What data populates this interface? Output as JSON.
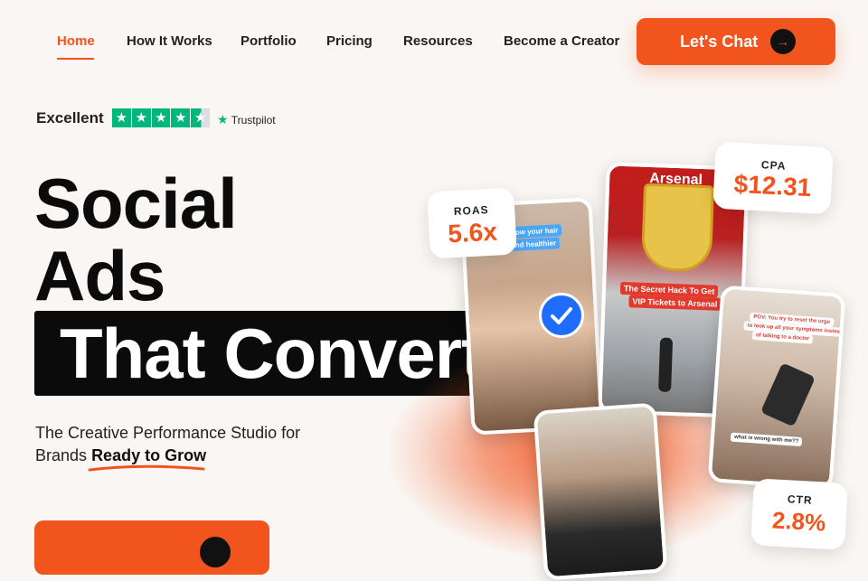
{
  "nav": {
    "items": [
      {
        "label": "Home",
        "active": true
      },
      {
        "label": "How It Works"
      },
      {
        "label": "Portfolio"
      },
      {
        "label": "Pricing"
      },
      {
        "label": "Resources"
      },
      {
        "label": "Become a Creator"
      }
    ],
    "cta_label": "Let's Chat"
  },
  "trustpilot": {
    "rating_word": "Excellent",
    "stars": 4.5,
    "brand": "Trustpilot"
  },
  "hero": {
    "line1": "Social",
    "line2": "Ads",
    "line3": "That Convert",
    "subtitle_start": "The Creative Performance Studio for Brands",
    "subtitle_highlight": "Ready to Grow"
  },
  "metrics": {
    "roas": {
      "label": "ROAS",
      "value": "5.6x"
    },
    "cpa": {
      "label": "CPA",
      "value": "$12.31"
    },
    "ctr": {
      "label": "CTR",
      "value": "2.8%"
    }
  },
  "captions": {
    "hair_line1": "to grow your hair",
    "hair_line2": "ter and healthier",
    "arsenal_line1": "The Secret Hack To Get",
    "arsenal_line2": "VIP Tickets to Arsenal",
    "arsenal_sign": "Arsenal",
    "phone_caption1": "POV: You try to reset the urge",
    "phone_caption2": "to look up all your symptoms instead",
    "phone_caption3": "of talking to a doctor",
    "phone_chat": "what is wrong with me??"
  },
  "colors": {
    "accent": "#f1541d",
    "trustpilot_green": "#00b67a",
    "verify_blue": "#1f6dff"
  }
}
